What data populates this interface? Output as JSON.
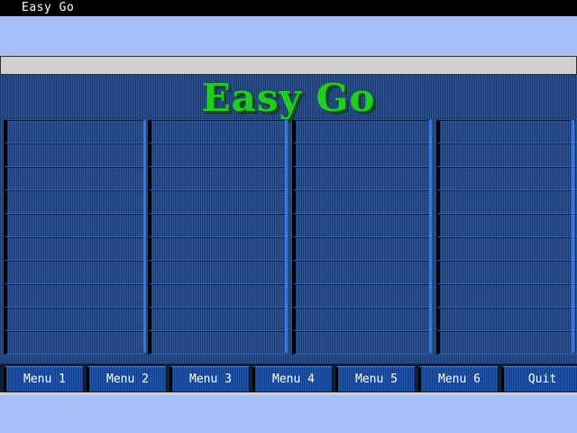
{
  "window": {
    "title": "Easy Go"
  },
  "panel": {
    "logo_text": "Easy Go"
  },
  "grid": {
    "columns": 4,
    "rows": 10
  },
  "menu": {
    "buttons": [
      {
        "label": "Menu 1"
      },
      {
        "label": "Menu 2"
      },
      {
        "label": "Menu 3"
      },
      {
        "label": "Menu 4"
      },
      {
        "label": "Menu 5"
      },
      {
        "label": "Menu 6"
      },
      {
        "label": "Quit"
      }
    ]
  },
  "colors": {
    "background": "#a6bff6",
    "panel": "#1d4585",
    "logo": "#22cc22",
    "titlebar": "#000000"
  }
}
